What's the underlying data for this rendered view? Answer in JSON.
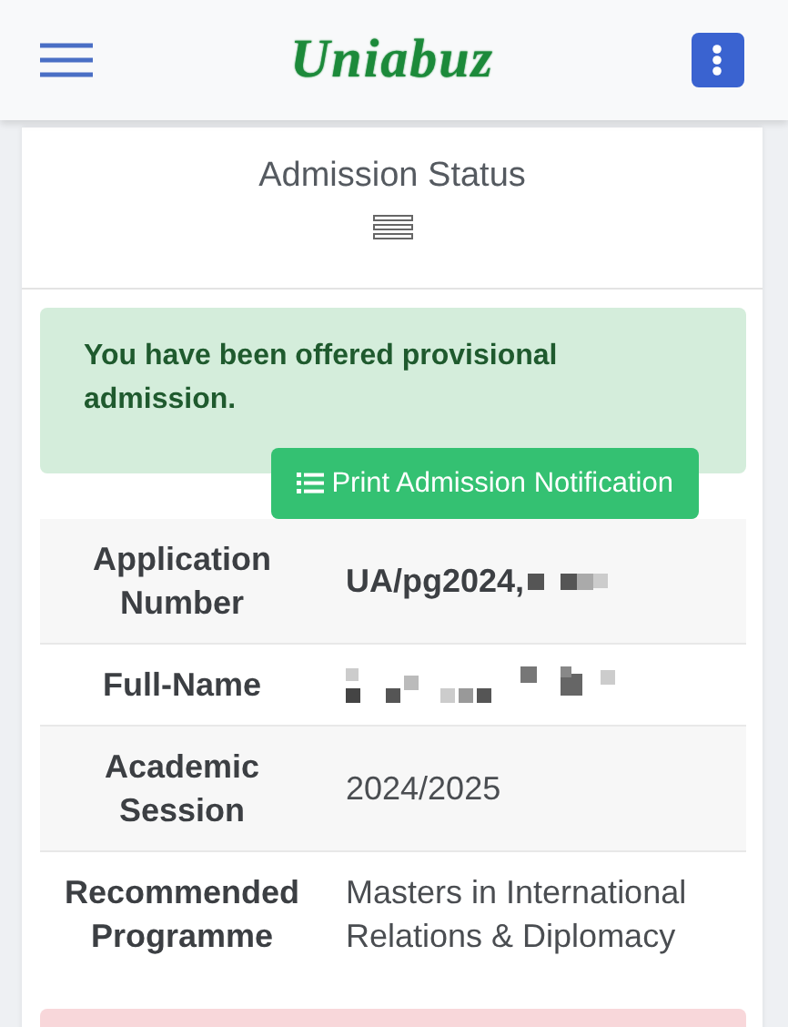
{
  "header": {
    "logo": "Uniabuz"
  },
  "card": {
    "title": "Admission Status",
    "alert": {
      "kind": "success",
      "message": "You have been offered provisional admission."
    },
    "print_button": {
      "label": "Print Admission Notification"
    },
    "rows": [
      {
        "label": "Application Number",
        "kind": "partly-redacted",
        "value": "UA/pg2024,"
      },
      {
        "label": "Full-Name",
        "kind": "redacted"
      },
      {
        "label": "Academic Session",
        "kind": "plain",
        "value": "2024/2025"
      },
      {
        "label": "Recommended Programme",
        "kind": "plain",
        "value": "Masters in International Relations & Diplomacy"
      }
    ],
    "next_alert": {
      "kind": "danger"
    }
  }
}
